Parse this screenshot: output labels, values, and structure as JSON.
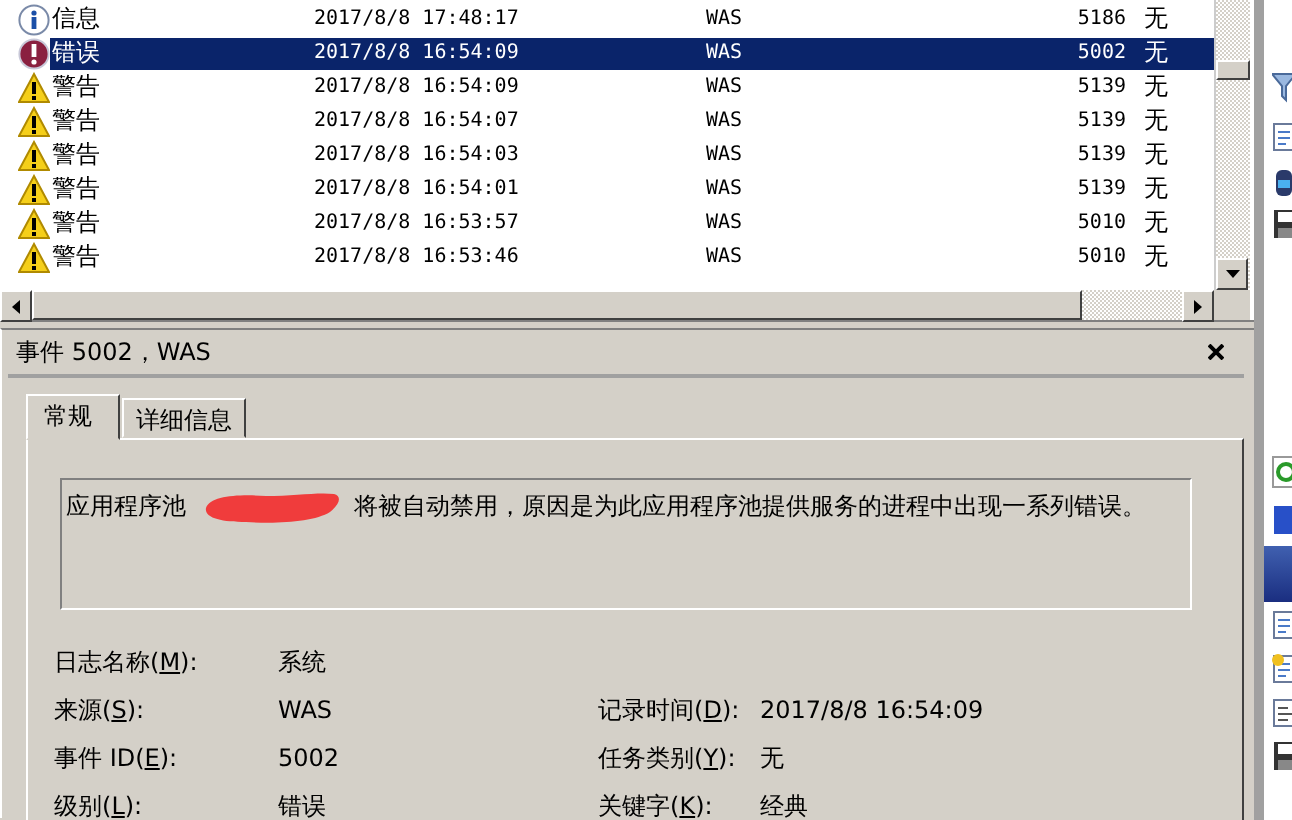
{
  "event_list": {
    "rows": [
      {
        "kind": "info",
        "level": "信息",
        "date_time": "2017/8/8 17:48:17",
        "source": "WAS",
        "event_id": "5186",
        "task_category": "无",
        "selected": false
      },
      {
        "kind": "error",
        "level": "错误",
        "date_time": "2017/8/8 16:54:09",
        "source": "WAS",
        "event_id": "5002",
        "task_category": "无",
        "selected": true
      },
      {
        "kind": "warning",
        "level": "警告",
        "date_time": "2017/8/8 16:54:09",
        "source": "WAS",
        "event_id": "5139",
        "task_category": "无",
        "selected": false
      },
      {
        "kind": "warning",
        "level": "警告",
        "date_time": "2017/8/8 16:54:07",
        "source": "WAS",
        "event_id": "5139",
        "task_category": "无",
        "selected": false
      },
      {
        "kind": "warning",
        "level": "警告",
        "date_time": "2017/8/8 16:54:03",
        "source": "WAS",
        "event_id": "5139",
        "task_category": "无",
        "selected": false
      },
      {
        "kind": "warning",
        "level": "警告",
        "date_time": "2017/8/8 16:54:01",
        "source": "WAS",
        "event_id": "5139",
        "task_category": "无",
        "selected": false
      },
      {
        "kind": "warning",
        "level": "警告",
        "date_time": "2017/8/8 16:53:57",
        "source": "WAS",
        "event_id": "5010",
        "task_category": "无",
        "selected": false
      },
      {
        "kind": "warning",
        "level": "警告",
        "date_time": "2017/8/8 16:53:46",
        "source": "WAS",
        "event_id": "5010",
        "task_category": "无",
        "selected": false
      }
    ]
  },
  "detail": {
    "title": "事件 5002，WAS",
    "tabs": [
      {
        "label": "常规",
        "selected": true
      },
      {
        "label": "详细信息",
        "selected": false
      }
    ],
    "message": {
      "before": "应用程序池",
      "redacted": true,
      "after": "将被自动禁用，原因是为此应用程序池提供服务的进程中出现一系列错误。"
    },
    "fields": [
      {
        "left": {
          "label_before": "日志名称(",
          "access_key": "M",
          "label_after": "):",
          "value": "系统"
        }
      },
      {
        "left": {
          "label_before": "来源(",
          "access_key": "S",
          "label_after": "):",
          "value": "WAS"
        },
        "right": {
          "label_before": "记录时间(",
          "access_key": "D",
          "label_after": "):",
          "value": "2017/8/8 16:54:09"
        }
      },
      {
        "left": {
          "label_before": "事件 ID(",
          "access_key": "E",
          "label_after": "):",
          "value": "5002"
        },
        "right": {
          "label_before": "任务类别(",
          "access_key": "Y",
          "label_after": "):",
          "value": "无"
        }
      },
      {
        "left": {
          "label_before": "级别(",
          "access_key": "L",
          "label_after": "):",
          "value": "错误"
        },
        "right": {
          "label_before": "关键字(",
          "access_key": "K",
          "label_after": "):",
          "value": "经典"
        }
      }
    ]
  }
}
